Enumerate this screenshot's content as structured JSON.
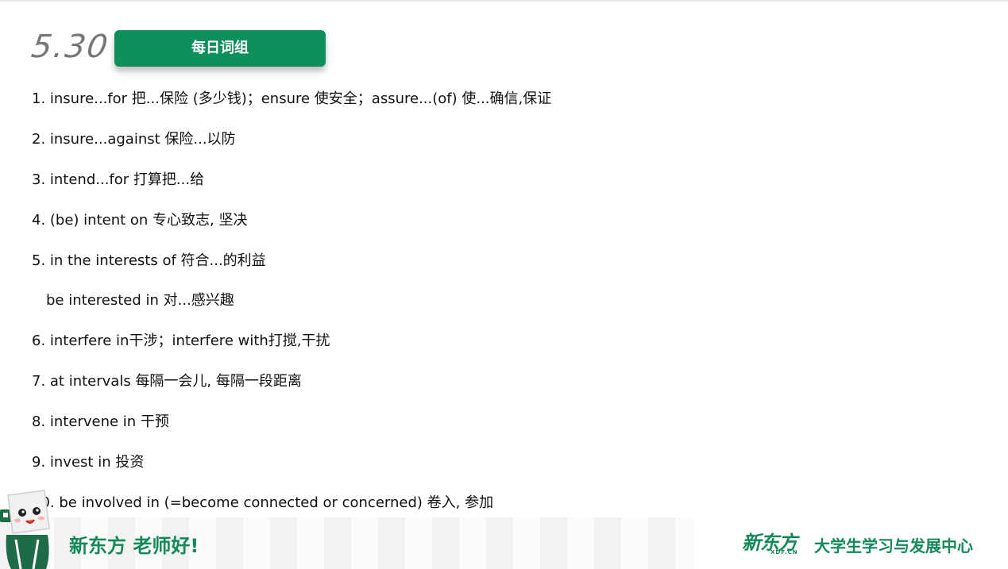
{
  "header": {
    "date": "5.30",
    "title": "每日词组"
  },
  "entries": [
    "1. insure...for 把...保险 (多少钱)；ensure 使安全；assure...(of) 使...确信,保证",
    "2. insure...against 保险...以防",
    "3. intend...for 打算把...给",
    "4. (be) intent on 专心致志, 坚决",
    "5. in the interests of 符合...的利益",
    "be interested in 对...感兴趣",
    "6. interfere in干涉；interfere with打搅,干扰",
    "7. at intervals 每隔一会儿, 每隔一段距离",
    "8. intervene in 干预",
    "9. invest in 投资",
    "10. be involved in (=become connected or concerned) 卷入, 参加"
  ],
  "footer": {
    "slogan": "新东方 老师好!",
    "logo_text": "新东方",
    "logo_sub": "XDF.CN",
    "center_name": "大学生学习与发展中心",
    "brand_color": "#13895a",
    "badge_color": "#0f8f5b"
  },
  "icons": {
    "mascot": "mascot-icon"
  }
}
